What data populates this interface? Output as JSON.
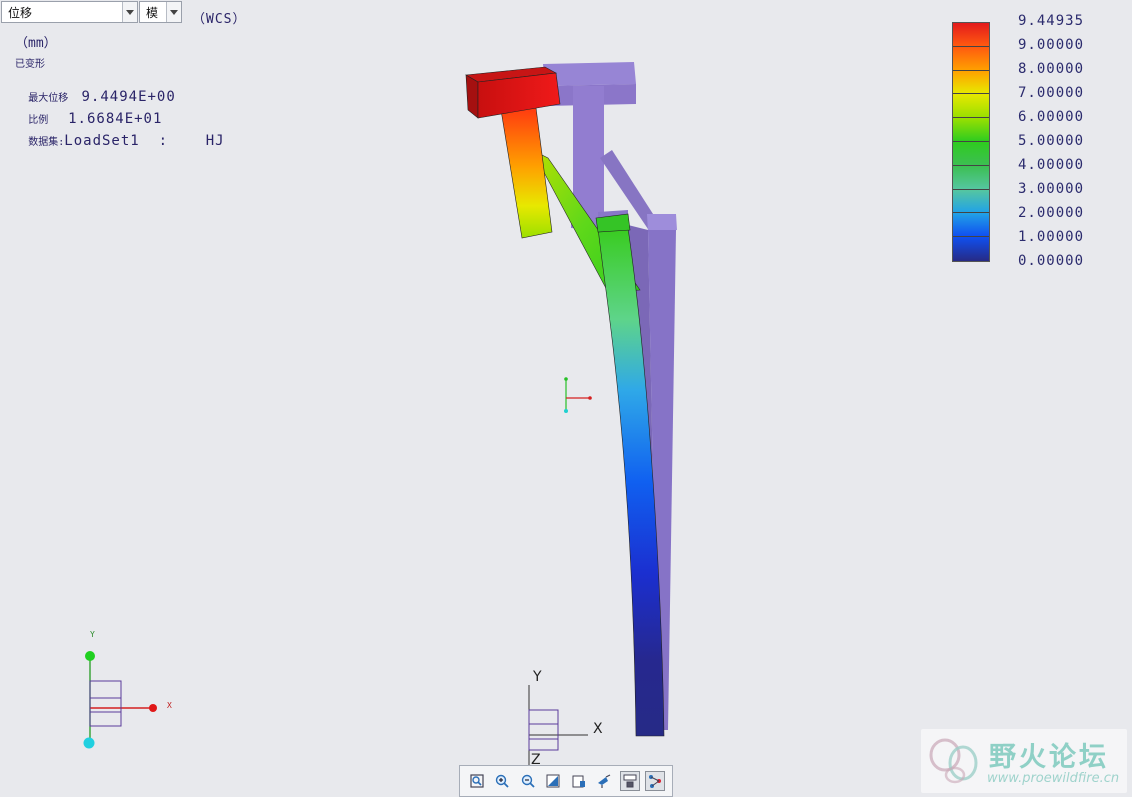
{
  "toolbar_top": {
    "result_type": "位移",
    "mode": "模",
    "coord_system": "（WCS）"
  },
  "info": {
    "units": "（mm）",
    "deformed": "已变形",
    "max_disp_label": "最大位移",
    "max_disp_value": "9.4494E+00",
    "scale_label": "比例",
    "scale_value": "1.6684E+01",
    "dataset_label": "数据集:",
    "dataset_value": "LoadSet1  :    HJ"
  },
  "legend": {
    "labels": [
      "9.44935",
      "9.00000",
      "8.00000",
      "7.00000",
      "6.00000",
      "5.00000",
      "4.00000",
      "3.00000",
      "2.00000",
      "1.00000",
      "0.00000"
    ],
    "colors": [
      "#e31a1c",
      "#ff5a10",
      "#ffa000",
      "#e8e800",
      "#9be000",
      "#2fcc1f",
      "#3cbf52",
      "#55c6a0",
      "#22a3e6",
      "#1050f0",
      "#262a86"
    ]
  },
  "triad": {
    "y": "Y",
    "x": "X",
    "z": "Z"
  },
  "view_toolbar": {
    "buttons": [
      "refit-icon",
      "zoom-in-icon",
      "zoom-out-icon",
      "repaint-icon",
      "saved-views-icon",
      "spin-center-icon",
      "display-style-icon",
      "model-tree-icon"
    ]
  },
  "watermark": {
    "title": "野火论坛",
    "url": "www.proewildfire.cn"
  },
  "colors": {
    "background": "#e8e9ed",
    "undeformed": "#7b5fc4"
  }
}
